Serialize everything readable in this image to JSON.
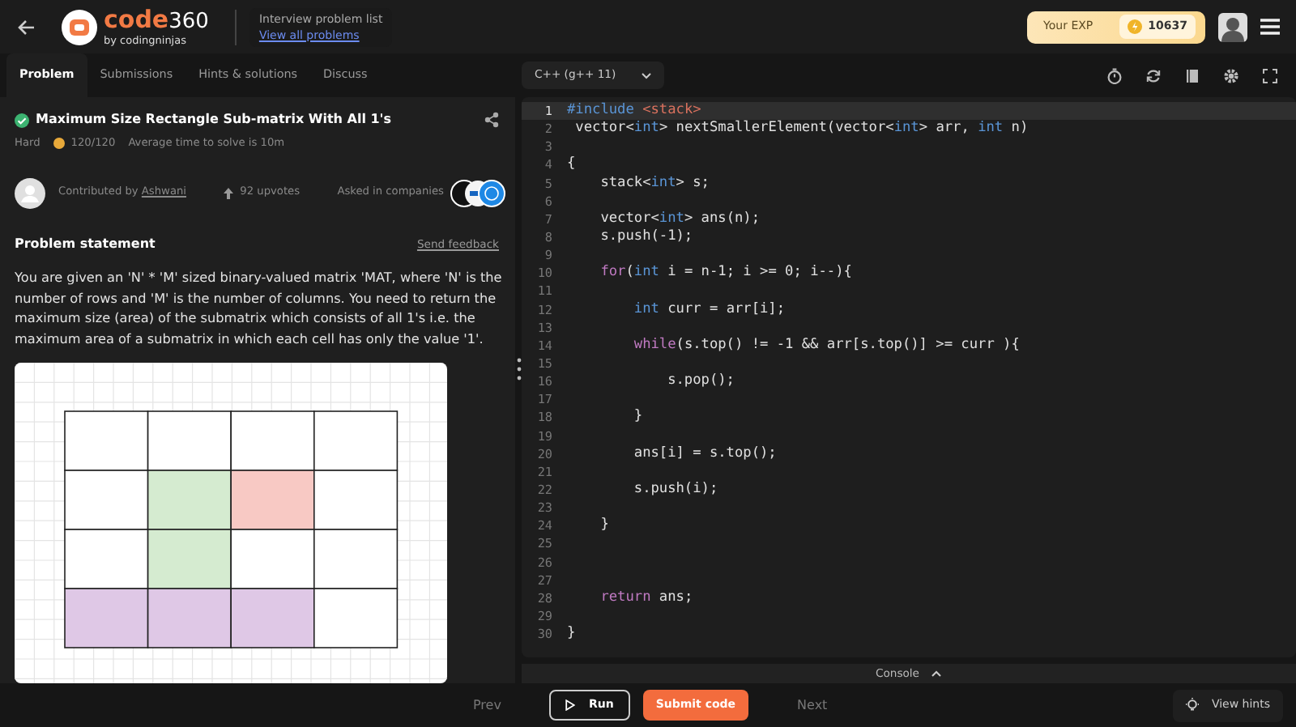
{
  "header": {
    "logo_name": "code",
    "logo_suffix": "360",
    "logo_byline": "by codingninjas",
    "nav_caption": "Interview problem list",
    "nav_link": "View all problems",
    "exp_label": "Your EXP",
    "exp_value": "10637"
  },
  "left_tabs": [
    {
      "label": "Problem",
      "selected": true
    },
    {
      "label": "Submissions",
      "selected": false
    },
    {
      "label": "Hints & solutions",
      "selected": false
    },
    {
      "label": "Discuss",
      "selected": false
    }
  ],
  "problem": {
    "title": "Maximum Size Rectangle Sub-matrix With All 1's",
    "solved": true,
    "difficulty": "Hard",
    "score": "120/120",
    "avg_time": "Average time to solve is 10m",
    "contributed_label": "Contributed by",
    "contributor": "Ashwani",
    "upvotes": "92 upvotes",
    "companies_label": "Asked in companies"
  },
  "statement": {
    "heading": "Problem statement",
    "feedback": "Send feedback",
    "text": "You are given an 'N' * 'M' sized binary-valued matrix 'MAT, where 'N' is the number of rows and 'M' is the number of columns. You need to return the maximum size (area) of the submatrix which consists of all 1's i.e. the maximum area of a submatrix in which each cell has only the value '1'.",
    "figure": {
      "rows": [
        {
          "cells": [
            {
              "color": "#ffffff"
            },
            {
              "color": "#ffffff"
            },
            {
              "color": "#ffffff"
            },
            {
              "color": "#ffffff"
            }
          ]
        },
        {
          "cells": [
            {
              "color": "#ffffff"
            },
            {
              "color": "#d5ebd0"
            },
            {
              "color": "#f8c9c4"
            },
            {
              "color": "#ffffff"
            }
          ]
        },
        {
          "cells": [
            {
              "color": "#ffffff"
            },
            {
              "color": "#d5ebd0"
            },
            {
              "color": "#ffffff"
            },
            {
              "color": "#ffffff"
            }
          ]
        },
        {
          "cells": [
            {
              "color": "#dfc8e6"
            },
            {
              "color": "#dfc8e6"
            },
            {
              "color": "#dfc8e6"
            },
            {
              "color": "#ffffff"
            }
          ]
        }
      ]
    }
  },
  "editor": {
    "language": "C++ (g++ 11)",
    "lines": [
      {
        "number": "1",
        "current": true,
        "tokens": [
          {
            "kind": "directive",
            "text": "#include "
          },
          {
            "kind": "header",
            "text": "<stack>"
          }
        ]
      },
      {
        "number": "2",
        "current": false,
        "tokens": [
          {
            "kind": "plain",
            "text": " vector<"
          },
          {
            "kind": "type",
            "text": "int"
          },
          {
            "kind": "plain",
            "text": "> nextSmallerElement(vector<"
          },
          {
            "kind": "type",
            "text": "int"
          },
          {
            "kind": "plain",
            "text": "> arr, "
          },
          {
            "kind": "type",
            "text": "int"
          },
          {
            "kind": "plain",
            "text": " n)"
          }
        ]
      },
      {
        "number": "3",
        "current": false
      },
      {
        "number": "4",
        "current": false,
        "tokens": [
          {
            "kind": "plain",
            "text": "{"
          }
        ]
      },
      {
        "number": "5",
        "current": false,
        "tokens": [
          {
            "kind": "plain",
            "text": "    stack<"
          },
          {
            "kind": "type",
            "text": "int"
          },
          {
            "kind": "plain",
            "text": "> s;"
          }
        ]
      },
      {
        "number": "6",
        "current": false
      },
      {
        "number": "7",
        "current": false,
        "tokens": [
          {
            "kind": "plain",
            "text": "    vector<"
          },
          {
            "kind": "type",
            "text": "int"
          },
          {
            "kind": "plain",
            "text": "> ans(n);"
          }
        ]
      },
      {
        "number": "8",
        "current": false,
        "tokens": [
          {
            "kind": "plain",
            "text": "    s.push(-1);"
          }
        ]
      },
      {
        "number": "9",
        "current": false
      },
      {
        "number": "10",
        "current": false,
        "tokens": [
          {
            "kind": "keyword",
            "text": "    for"
          },
          {
            "kind": "plain",
            "text": "("
          },
          {
            "kind": "type",
            "text": "int"
          },
          {
            "kind": "plain",
            "text": " i = n-1; i >= 0; i--){"
          }
        ]
      },
      {
        "number": "11",
        "current": false
      },
      {
        "number": "12",
        "current": false,
        "tokens": [
          {
            "kind": "type",
            "text": "        int"
          },
          {
            "kind": "plain",
            "text": " curr = arr[i];"
          }
        ]
      },
      {
        "number": "13",
        "current": false
      },
      {
        "number": "14",
        "current": false,
        "tokens": [
          {
            "kind": "keyword",
            "text": "        while"
          },
          {
            "kind": "plain",
            "text": "(s.top() != -1 && arr[s.top()] >= curr ){"
          }
        ]
      },
      {
        "number": "15",
        "current": false
      },
      {
        "number": "16",
        "current": false,
        "tokens": [
          {
            "kind": "plain",
            "text": "            s.pop();"
          }
        ]
      },
      {
        "number": "17",
        "current": false
      },
      {
        "number": "18",
        "current": false,
        "tokens": [
          {
            "kind": "plain",
            "text": "        }"
          }
        ]
      },
      {
        "number": "19",
        "current": false
      },
      {
        "number": "20",
        "current": false,
        "tokens": [
          {
            "kind": "plain",
            "text": "        ans[i] = s.top();"
          }
        ]
      },
      {
        "number": "21",
        "current": false
      },
      {
        "number": "22",
        "current": false,
        "tokens": [
          {
            "kind": "plain",
            "text": "        s.push(i);"
          }
        ]
      },
      {
        "number": "23",
        "current": false
      },
      {
        "number": "24",
        "current": false,
        "tokens": [
          {
            "kind": "plain",
            "text": "    }"
          }
        ]
      },
      {
        "number": "25",
        "current": false
      },
      {
        "number": "26",
        "current": false
      },
      {
        "number": "27",
        "current": false
      },
      {
        "number": "28",
        "current": false,
        "tokens": [
          {
            "kind": "keyword",
            "text": "    return"
          },
          {
            "kind": "plain",
            "text": " ans;"
          }
        ]
      },
      {
        "number": "29",
        "current": false
      },
      {
        "number": "30",
        "current": false,
        "tokens": [
          {
            "kind": "plain",
            "text": "}"
          }
        ]
      }
    ]
  },
  "console": {
    "label": "Console"
  },
  "footer": {
    "prev": "Prev",
    "run": "Run",
    "submit": "Submit code",
    "next": "Next",
    "hints": "View hints"
  }
}
